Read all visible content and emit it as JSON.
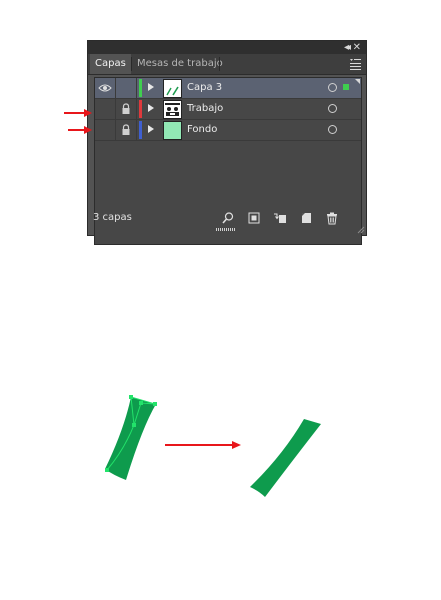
{
  "panel": {
    "collapse_glyph": "◂◂",
    "close_glyph": "✕",
    "tabs": [
      {
        "label": "Capas",
        "active": true
      },
      {
        "label": "Mesas de trabajo",
        "active": false
      }
    ],
    "menu_icon": "panel-menu-icon",
    "layers": [
      {
        "name": "Capa 3",
        "visible": true,
        "locked": false,
        "color": "#3fcf4f",
        "selected": true,
        "thumb": "stroke-thumb",
        "sel_color": "#3fcf4f"
      },
      {
        "name": "Trabajo",
        "visible": false,
        "locked": true,
        "color": "#e0393c",
        "selected": false,
        "thumb": "artboard-thumb"
      },
      {
        "name": "Fondo",
        "visible": false,
        "locked": true,
        "color": "#3f5fd0",
        "selected": false,
        "thumb": "green-thumb",
        "thumb_color": "#92e8b5"
      }
    ],
    "footer": {
      "count": "3 capas",
      "buttons": [
        "locate-object-icon",
        "make-clipping-mask-icon",
        "create-sublayer-icon",
        "create-new-layer-icon",
        "delete-layer-icon"
      ]
    }
  },
  "illustration": {
    "arrow_color": "#e8161b",
    "stroke_color": "#0e9b4d",
    "anchor_color": "#22e36a"
  }
}
